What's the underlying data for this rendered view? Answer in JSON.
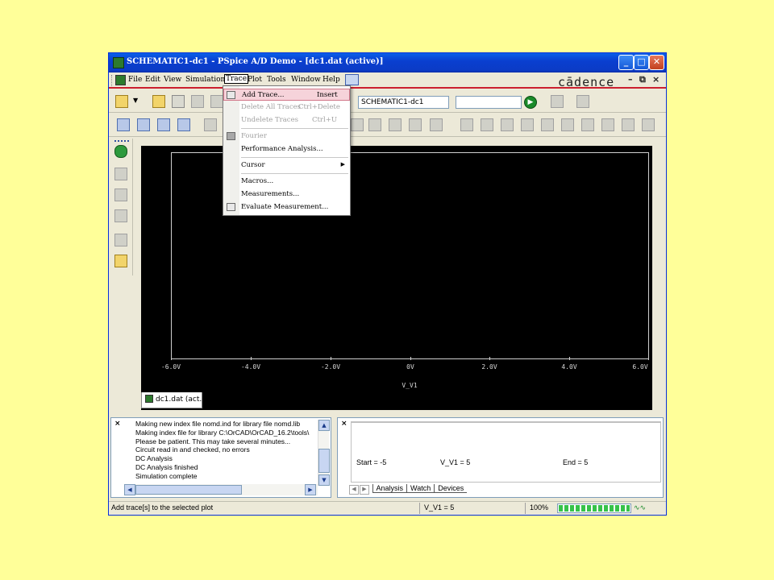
{
  "window": {
    "title": "SCHEMATIC1-dc1 - PSpice A/D Demo - [dc1.dat (active)]",
    "brand": "cādence"
  },
  "menubar": {
    "items": [
      "File",
      "Edit",
      "View",
      "Simulation",
      "Trace",
      "Plot",
      "Tools",
      "Window",
      "Help"
    ]
  },
  "toolbar": {
    "profile_combo": "SCHEMATIC1-dc1",
    "second_combo": ""
  },
  "trace_menu": {
    "items": [
      {
        "label": "Add Trace...",
        "shortcut": "Insert",
        "state": "highlighted"
      },
      {
        "label": "Delete All Traces",
        "shortcut": "Ctrl+Delete",
        "state": "disabled"
      },
      {
        "label": "Undelete Traces",
        "shortcut": "Ctrl+U",
        "state": "disabled"
      },
      {
        "label": "Fourier",
        "shortcut": "",
        "state": "disabled"
      },
      {
        "label": "Performance Analysis...",
        "shortcut": "",
        "state": "enabled"
      },
      {
        "label": "Cursor",
        "shortcut": "",
        "state": "submenu"
      },
      {
        "label": "Macros...",
        "shortcut": "",
        "state": "enabled"
      },
      {
        "label": "Measurements...",
        "shortcut": "",
        "state": "enabled"
      },
      {
        "label": "Evaluate Measurement...",
        "shortcut": "",
        "state": "enabled"
      }
    ]
  },
  "plot": {
    "x_ticks": [
      "-6.0V",
      "-4.0V",
      "-2.0V",
      "0V",
      "2.0V",
      "4.0V",
      "6.0V"
    ],
    "x_label": "V_V1",
    "tab_label": "dc1.dat (act..."
  },
  "output": {
    "lines": [
      "Making new index file nomd.ind for library file nomd.lib",
      "Making index file for library C:\\OrCAD\\OrCAD_16.2\\tools\\",
      "Please be patient. This may take several minutes...",
      "Circuit read in and checked, no errors",
      "DC Analysis",
      "DC Analysis finished",
      "Simulation complete"
    ]
  },
  "watch": {
    "start": "Start = -5",
    "current": "V_V1 =  5",
    "end": "End = 5",
    "tabs": [
      "Analysis",
      "Watch",
      "Devices"
    ]
  },
  "status": {
    "message": "Add trace[s] to the selected plot",
    "value": "V_V1 = 5",
    "zoom": "100%",
    "progress": 1.0
  }
}
